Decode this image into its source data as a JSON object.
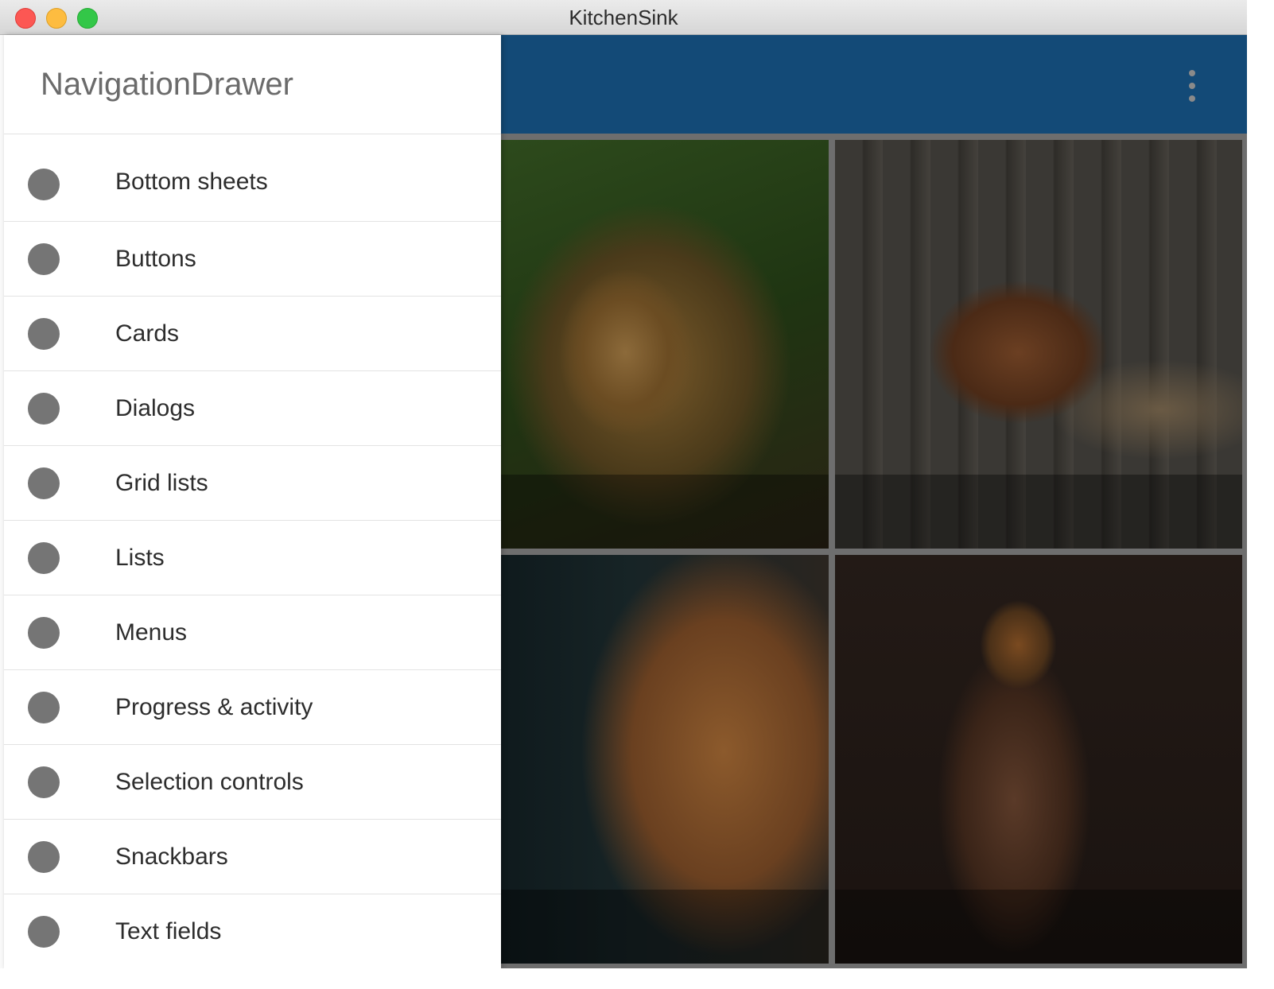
{
  "window": {
    "title": "KitchenSink"
  },
  "drawer": {
    "title": "NavigationDrawer",
    "items": [
      {
        "label": "Bottom sheets"
      },
      {
        "label": "Buttons"
      },
      {
        "label": "Cards"
      },
      {
        "label": "Dialogs"
      },
      {
        "label": "Grid lists"
      },
      {
        "label": "Lists"
      },
      {
        "label": "Menus"
      },
      {
        "label": "Progress & activity"
      },
      {
        "label": "Selection controls"
      },
      {
        "label": "Snackbars"
      },
      {
        "label": "Text fields"
      }
    ]
  },
  "appbar": {
    "color": "#134a77",
    "overflow_icon": "more-vert-icon"
  },
  "grid": {
    "tiles": [
      {
        "subject": "lion"
      },
      {
        "subject": "guitar"
      },
      {
        "subject": "cat"
      },
      {
        "subject": "lightbulb"
      }
    ]
  }
}
